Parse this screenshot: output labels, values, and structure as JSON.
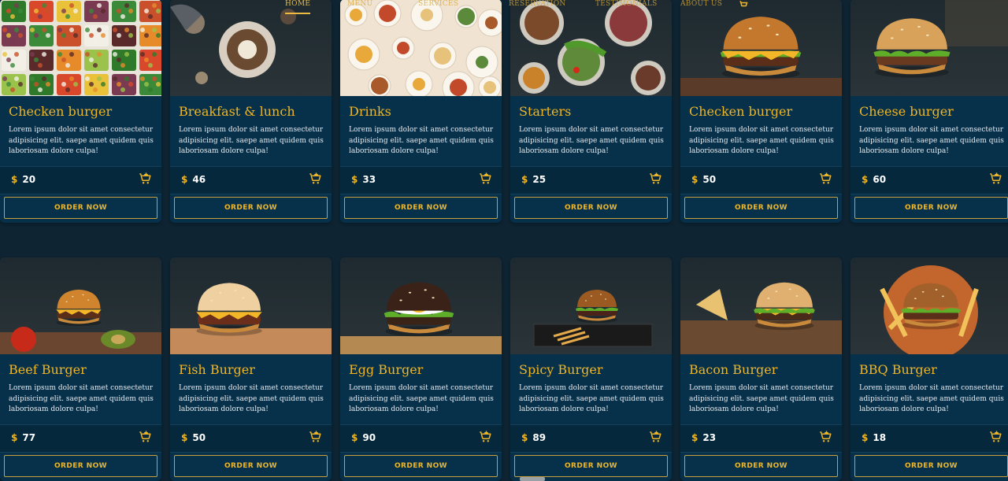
{
  "nav": {
    "items": [
      {
        "label": "HOME",
        "active": true
      },
      {
        "label": "MENU",
        "active": false
      },
      {
        "label": "SERVICES",
        "active": false
      },
      {
        "label": "RESERVATION",
        "active": false
      },
      {
        "label": "TESTIMONIALS",
        "active": false
      },
      {
        "label": "ABOUT US",
        "active": false
      }
    ],
    "cart_icon": "cart-icon"
  },
  "currency": "$",
  "order_label": "ORDER NOW",
  "cards": [
    {
      "title": "Checken burger",
      "desc": "Lorem ipsum dolor sit amet consectetur adipisicing elit. saepe amet quidem quis laboriosam dolore culpa!",
      "price": "20",
      "image": "salad-bar-photo"
    },
    {
      "title": "Breakfast & lunch",
      "desc": "Lorem ipsum dolor sit amet consectetur adipisicing elit. saepe amet quidem quis laboriosam dolore culpa!",
      "price": "46",
      "image": "breakfast-photo"
    },
    {
      "title": "Drinks",
      "desc": "Lorem ipsum dolor sit amet consectetur adipisicing elit. saepe amet quidem quis laboriosam dolore culpa!",
      "price": "33",
      "image": "brunch-table-photo"
    },
    {
      "title": "Starters",
      "desc": "Lorem ipsum dolor sit amet consectetur adipisicing elit. saepe amet quidem quis laboriosam dolore culpa!",
      "price": "25",
      "image": "starters-photo"
    },
    {
      "title": "Checken burger",
      "desc": "Lorem ipsum dolor sit amet consectetur adipisicing elit. saepe amet quidem quis laboriosam dolore culpa!",
      "price": "50",
      "image": "burger-photo"
    },
    {
      "title": "Cheese burger",
      "desc": "Lorem ipsum dolor sit amet consectetur adipisicing elit. saepe amet quidem quis laboriosam dolore culpa!",
      "price": "60",
      "image": "cheeseburger-photo"
    },
    {
      "title": "Beef Burger",
      "desc": "Lorem ipsum dolor sit amet consectetur adipisicing elit. saepe amet quidem quis laboriosam dolore culpa!",
      "price": "77",
      "image": "beef-burger-photo"
    },
    {
      "title": "Fish Burger",
      "desc": "Lorem ipsum dolor sit amet consectetur adipisicing elit. saepe amet quidem quis laboriosam dolore culpa!",
      "price": "50",
      "image": "fish-burger-photo"
    },
    {
      "title": "Egg Burger",
      "desc": "Lorem ipsum dolor sit amet consectetur adipisicing elit. saepe amet quidem quis laboriosam dolore culpa!",
      "price": "90",
      "image": "egg-burger-photo"
    },
    {
      "title": "Spicy Burger",
      "desc": "Lorem ipsum dolor sit amet consectetur adipisicing elit. saepe amet quidem quis laboriosam dolore culpa!",
      "price": "89",
      "image": "spicy-burger-photo"
    },
    {
      "title": "Bacon Burger",
      "desc": "Lorem ipsum dolor sit amet consectetur adipisicing elit. saepe amet quidem quis laboriosam dolore culpa!",
      "price": "23",
      "image": "bacon-burger-photo"
    },
    {
      "title": "BBQ Burger",
      "desc": "Lorem ipsum dolor sit amet consectetur adipisicing elit. saepe amet quidem quis laboriosam dolore culpa!",
      "price": "18",
      "image": "bbq-burger-photo"
    }
  ],
  "colors": {
    "accent": "#f0b623",
    "card_bg": "#07304a",
    "page_bg": "#0e2433"
  }
}
